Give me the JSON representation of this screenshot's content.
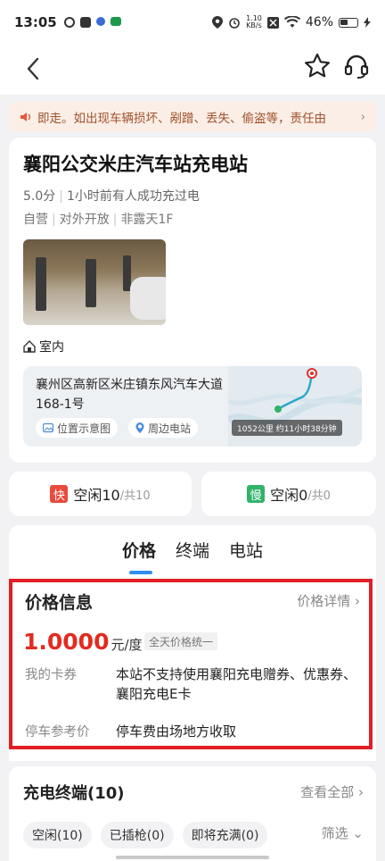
{
  "status_bar": {
    "time": "13:05",
    "speed_top": "1.10",
    "speed_bottom": "KB/s",
    "battery": "46%"
  },
  "notice": {
    "text": "即走。如出现车辆损坏、剐蹭、丢失、偷盗等，责任由",
    "chevron": "›"
  },
  "station": {
    "name": "襄阳公交米庄汽车站充电站",
    "score": "5.0分",
    "recent": "1小时前有人成功充过电",
    "tags": [
      "自营",
      "对外开放",
      "非露天1F"
    ],
    "indoor": "室内",
    "address": "襄州区高新区米庄镇东风汽车大道168-1号",
    "btn_location": "位置示意图",
    "btn_nearby": "周边电站",
    "distance": "1052公里  约11小时38分钟"
  },
  "availability": {
    "fast_tag": "快",
    "fast_text": "空闲10",
    "fast_total": "/共10",
    "slow_tag": "慢",
    "slow_text": "空闲0",
    "slow_total": "/共0"
  },
  "tabs": [
    "价格",
    "终端",
    "电站"
  ],
  "price": {
    "title": "价格信息",
    "detail": "价格详情",
    "value": "1.0000",
    "unit": "元/度",
    "uniform": "全天价格统一",
    "coupon_label": "我的卡券",
    "coupon_value": "本站不支持使用襄阳充电赠券、优惠券、襄阳充电E卡",
    "parking_label": "停车参考价",
    "parking_value": "停车费由场地方收取"
  },
  "terminals": {
    "title": "充电终端(10)",
    "view_all": "查看全部",
    "filters": [
      "空闲(10)",
      "已插枪(0)",
      "即将充满(0)"
    ],
    "screen": "筛选"
  },
  "colors": {
    "accent_red": "#e22b20",
    "tab_blue": "#2f8ff0",
    "highlight_border": "#e01f26"
  }
}
